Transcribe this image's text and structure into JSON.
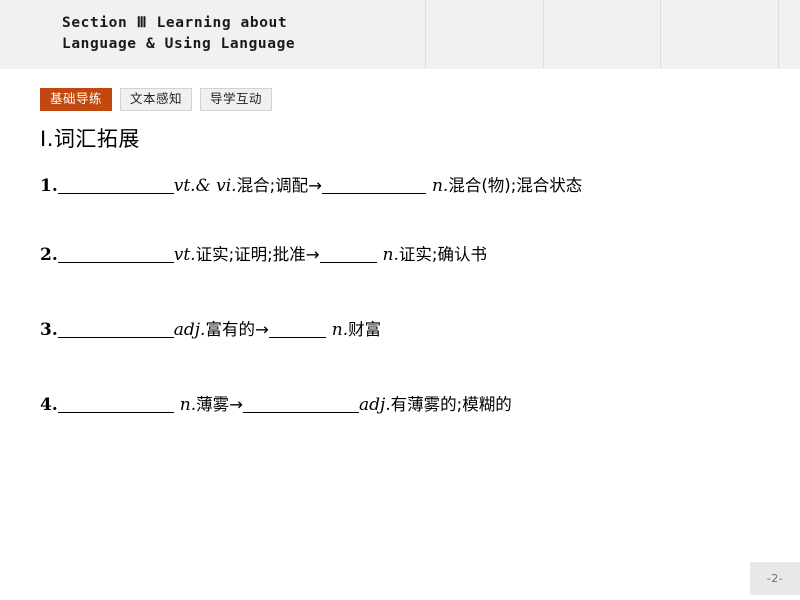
{
  "header": {
    "title": "Section Ⅲ  Learning about\nLanguage & Using Language",
    "divider_positions": [
      425,
      543,
      660,
      778
    ]
  },
  "tabs": [
    {
      "label": "基础导练",
      "active": true
    },
    {
      "label": "文本感知",
      "active": false
    },
    {
      "label": "导学互动",
      "active": false
    }
  ],
  "content": {
    "section_title": "Ⅰ.词汇拓展",
    "items": [
      {
        "num": "1.",
        "pos1": "vt.& vi.",
        "gloss1": "混合;调配",
        "arrow": "→",
        "pos2": "n.",
        "gloss2": "混合(物);混合状态"
      },
      {
        "num": "2.",
        "pos1": "vt.",
        "gloss1": "证实;证明;批准",
        "arrow": "→",
        "pos2": "n.",
        "gloss2": "证实;确认书"
      },
      {
        "num": "3.",
        "pos1": "adj.",
        "gloss1": "富有的",
        "arrow": "→",
        "pos2": "n.",
        "gloss2": "财富"
      },
      {
        "num": "4.",
        "pos1": "n.",
        "gloss1": "薄雾",
        "arrow": "→",
        "pos2": "adj.",
        "gloss2": "有薄雾的;模糊的"
      }
    ]
  },
  "footer": {
    "page_label": "-2-"
  },
  "colors": {
    "accent": "#c1480e",
    "header_band": "#f1f1f1",
    "tab_inactive": "#f0f0f0",
    "page_badge": "#e8e8e8"
  }
}
